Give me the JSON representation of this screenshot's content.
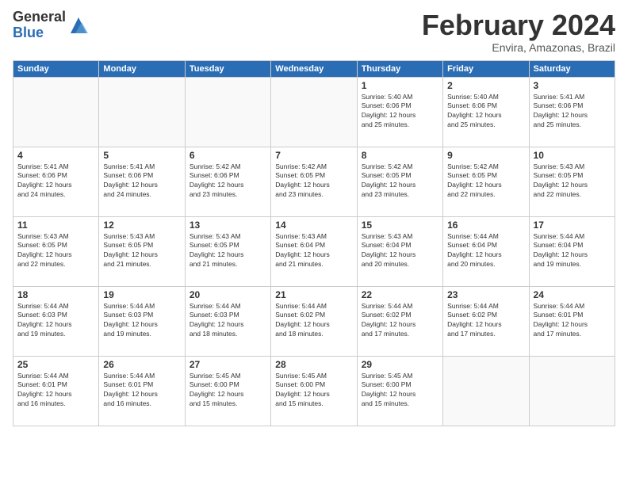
{
  "header": {
    "logo_general": "General",
    "logo_blue": "Blue",
    "title": "February 2024",
    "location": "Envira, Amazonas, Brazil"
  },
  "days_of_week": [
    "Sunday",
    "Monday",
    "Tuesday",
    "Wednesday",
    "Thursday",
    "Friday",
    "Saturday"
  ],
  "weeks": [
    [
      {
        "day": "",
        "info": ""
      },
      {
        "day": "",
        "info": ""
      },
      {
        "day": "",
        "info": ""
      },
      {
        "day": "",
        "info": ""
      },
      {
        "day": "1",
        "info": "Sunrise: 5:40 AM\nSunset: 6:06 PM\nDaylight: 12 hours\nand 25 minutes."
      },
      {
        "day": "2",
        "info": "Sunrise: 5:40 AM\nSunset: 6:06 PM\nDaylight: 12 hours\nand 25 minutes."
      },
      {
        "day": "3",
        "info": "Sunrise: 5:41 AM\nSunset: 6:06 PM\nDaylight: 12 hours\nand 25 minutes."
      }
    ],
    [
      {
        "day": "4",
        "info": "Sunrise: 5:41 AM\nSunset: 6:06 PM\nDaylight: 12 hours\nand 24 minutes."
      },
      {
        "day": "5",
        "info": "Sunrise: 5:41 AM\nSunset: 6:06 PM\nDaylight: 12 hours\nand 24 minutes."
      },
      {
        "day": "6",
        "info": "Sunrise: 5:42 AM\nSunset: 6:06 PM\nDaylight: 12 hours\nand 23 minutes."
      },
      {
        "day": "7",
        "info": "Sunrise: 5:42 AM\nSunset: 6:05 PM\nDaylight: 12 hours\nand 23 minutes."
      },
      {
        "day": "8",
        "info": "Sunrise: 5:42 AM\nSunset: 6:05 PM\nDaylight: 12 hours\nand 23 minutes."
      },
      {
        "day": "9",
        "info": "Sunrise: 5:42 AM\nSunset: 6:05 PM\nDaylight: 12 hours\nand 22 minutes."
      },
      {
        "day": "10",
        "info": "Sunrise: 5:43 AM\nSunset: 6:05 PM\nDaylight: 12 hours\nand 22 minutes."
      }
    ],
    [
      {
        "day": "11",
        "info": "Sunrise: 5:43 AM\nSunset: 6:05 PM\nDaylight: 12 hours\nand 22 minutes."
      },
      {
        "day": "12",
        "info": "Sunrise: 5:43 AM\nSunset: 6:05 PM\nDaylight: 12 hours\nand 21 minutes."
      },
      {
        "day": "13",
        "info": "Sunrise: 5:43 AM\nSunset: 6:05 PM\nDaylight: 12 hours\nand 21 minutes."
      },
      {
        "day": "14",
        "info": "Sunrise: 5:43 AM\nSunset: 6:04 PM\nDaylight: 12 hours\nand 21 minutes."
      },
      {
        "day": "15",
        "info": "Sunrise: 5:43 AM\nSunset: 6:04 PM\nDaylight: 12 hours\nand 20 minutes."
      },
      {
        "day": "16",
        "info": "Sunrise: 5:44 AM\nSunset: 6:04 PM\nDaylight: 12 hours\nand 20 minutes."
      },
      {
        "day": "17",
        "info": "Sunrise: 5:44 AM\nSunset: 6:04 PM\nDaylight: 12 hours\nand 19 minutes."
      }
    ],
    [
      {
        "day": "18",
        "info": "Sunrise: 5:44 AM\nSunset: 6:03 PM\nDaylight: 12 hours\nand 19 minutes."
      },
      {
        "day": "19",
        "info": "Sunrise: 5:44 AM\nSunset: 6:03 PM\nDaylight: 12 hours\nand 19 minutes."
      },
      {
        "day": "20",
        "info": "Sunrise: 5:44 AM\nSunset: 6:03 PM\nDaylight: 12 hours\nand 18 minutes."
      },
      {
        "day": "21",
        "info": "Sunrise: 5:44 AM\nSunset: 6:02 PM\nDaylight: 12 hours\nand 18 minutes."
      },
      {
        "day": "22",
        "info": "Sunrise: 5:44 AM\nSunset: 6:02 PM\nDaylight: 12 hours\nand 17 minutes."
      },
      {
        "day": "23",
        "info": "Sunrise: 5:44 AM\nSunset: 6:02 PM\nDaylight: 12 hours\nand 17 minutes."
      },
      {
        "day": "24",
        "info": "Sunrise: 5:44 AM\nSunset: 6:01 PM\nDaylight: 12 hours\nand 17 minutes."
      }
    ],
    [
      {
        "day": "25",
        "info": "Sunrise: 5:44 AM\nSunset: 6:01 PM\nDaylight: 12 hours\nand 16 minutes."
      },
      {
        "day": "26",
        "info": "Sunrise: 5:44 AM\nSunset: 6:01 PM\nDaylight: 12 hours\nand 16 minutes."
      },
      {
        "day": "27",
        "info": "Sunrise: 5:45 AM\nSunset: 6:00 PM\nDaylight: 12 hours\nand 15 minutes."
      },
      {
        "day": "28",
        "info": "Sunrise: 5:45 AM\nSunset: 6:00 PM\nDaylight: 12 hours\nand 15 minutes."
      },
      {
        "day": "29",
        "info": "Sunrise: 5:45 AM\nSunset: 6:00 PM\nDaylight: 12 hours\nand 15 minutes."
      },
      {
        "day": "",
        "info": ""
      },
      {
        "day": "",
        "info": ""
      }
    ]
  ]
}
